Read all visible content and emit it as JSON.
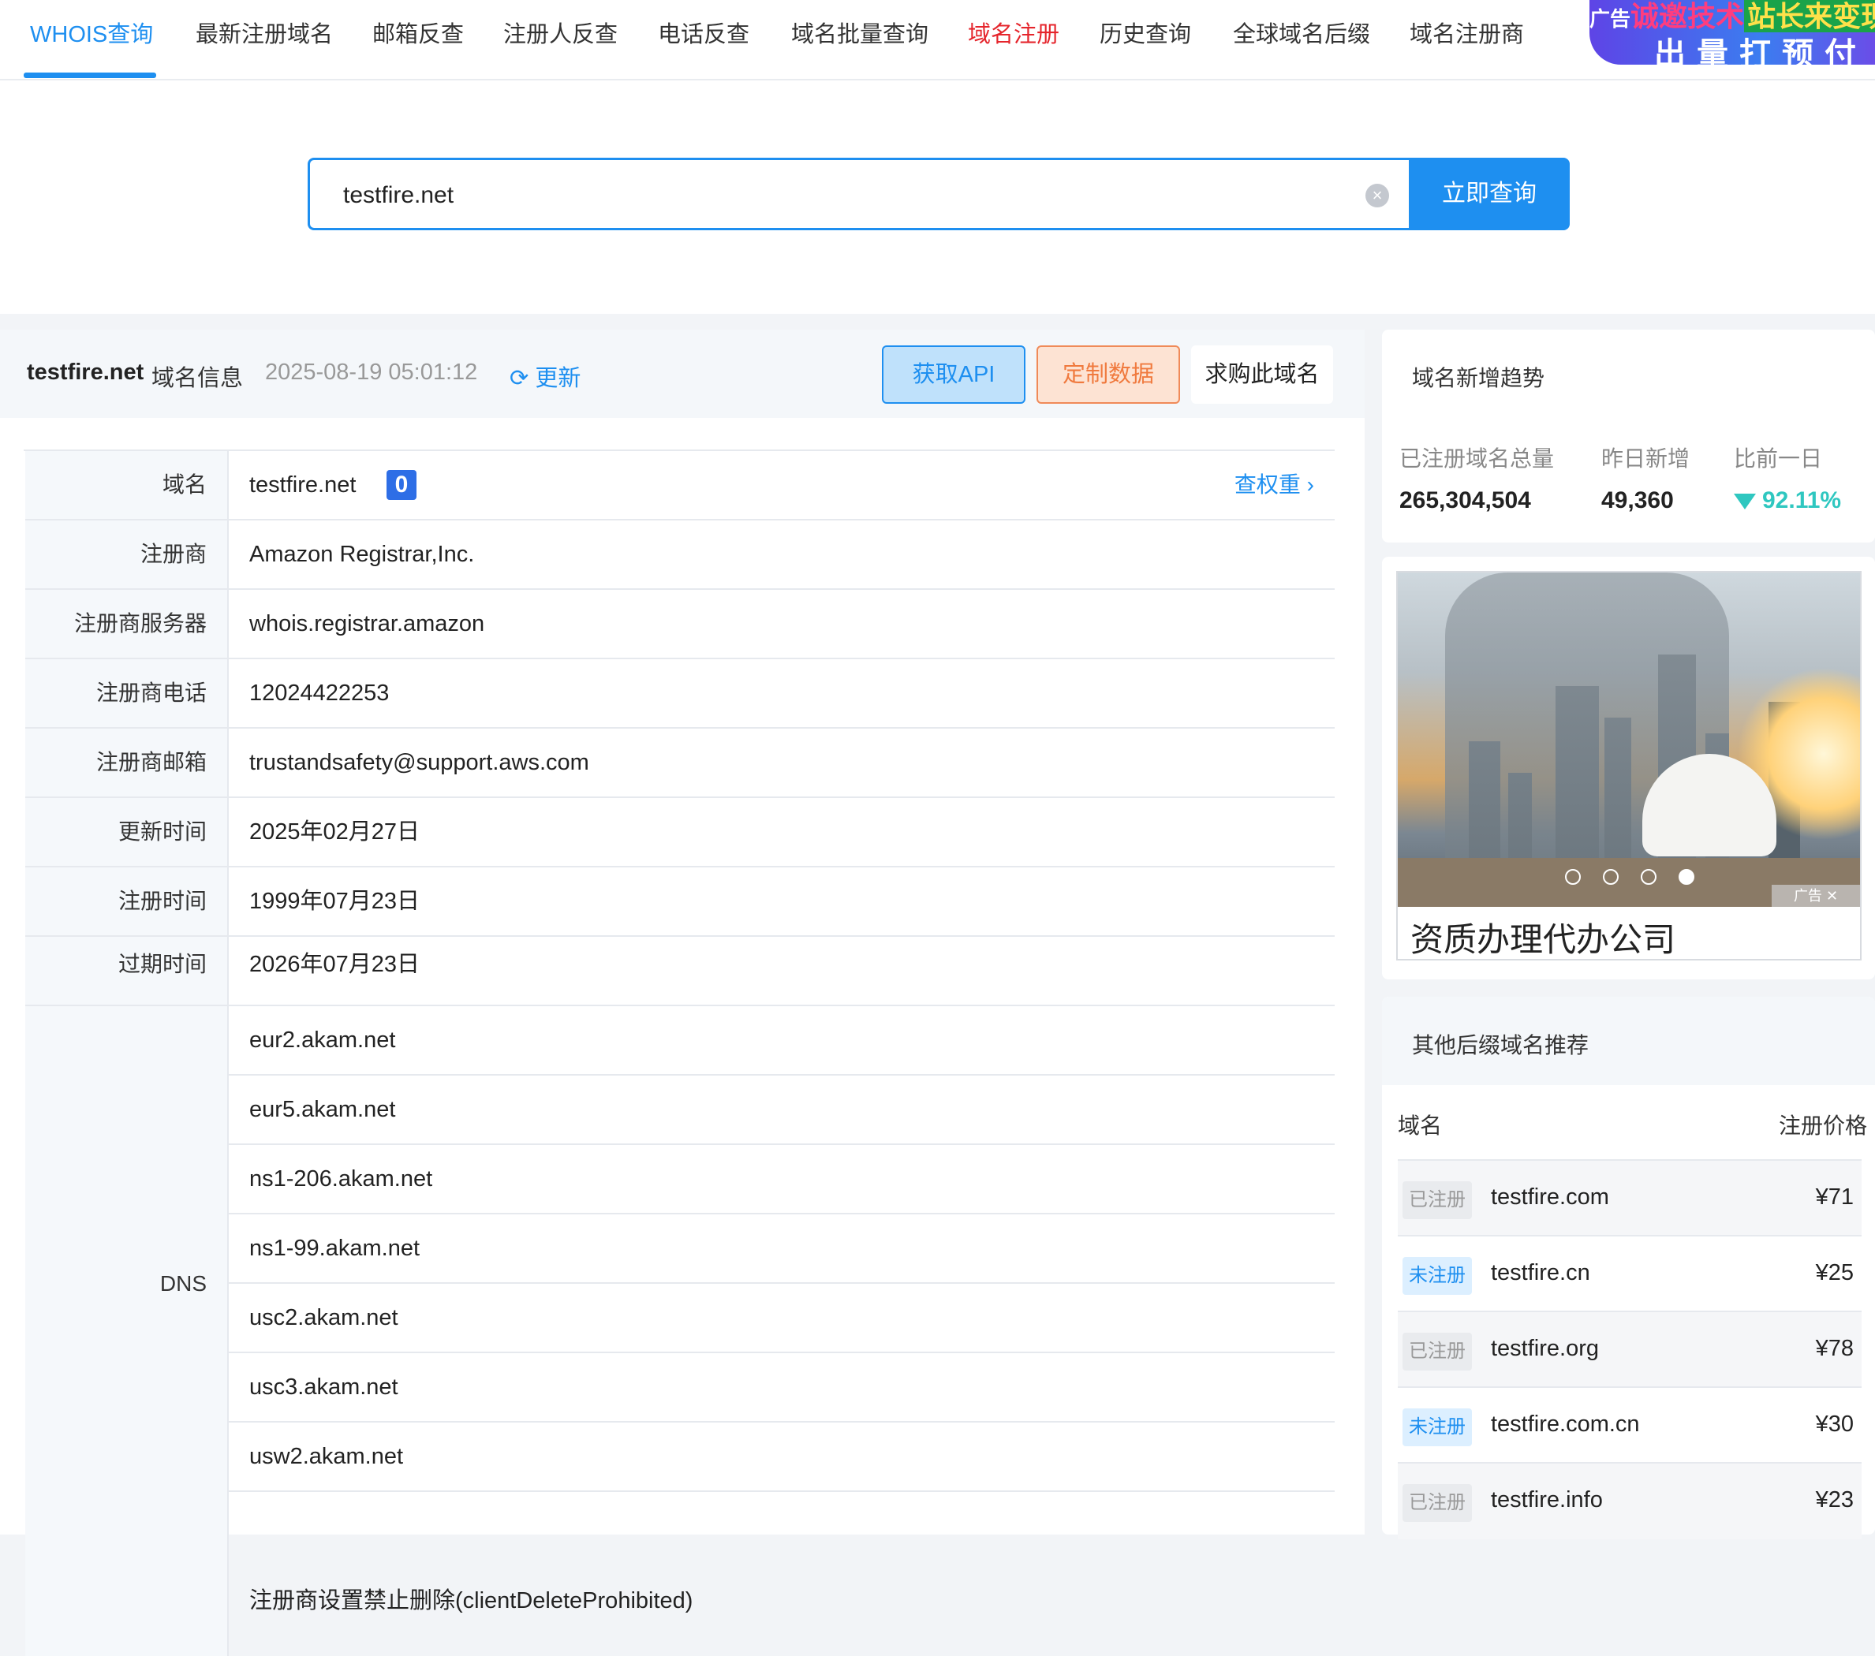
{
  "nav": {
    "items": [
      "WHOIS查询",
      "最新注册域名",
      "邮箱反查",
      "注册人反查",
      "电话反查",
      "域名批量查询",
      "域名注册",
      "历史查询",
      "全球域名后缀",
      "域名注册商"
    ],
    "ad_line1_a": "广告",
    "ad_line1_b": "诚邀技术",
    "ad_line1_c": "站长来变现",
    "ad_line2": "出量打预付"
  },
  "search": {
    "value": "testfire.net",
    "button": "立即查询",
    "clear_icon": "close-circle-icon"
  },
  "info": {
    "domain": "testfire.net",
    "suffix": "域名信息",
    "timestamp": "2025-08-19 05:01:12",
    "refresh_label": "更新",
    "btn_api": "获取API",
    "btn_custom": "定制数据",
    "btn_buy": "求购此域名",
    "rows": [
      {
        "label": "域名",
        "value": "testfire.net"
      },
      {
        "label": "注册商",
        "value": "Amazon Registrar,Inc."
      },
      {
        "label": "注册商服务器",
        "value": "whois.registrar.amazon"
      },
      {
        "label": "注册商电话",
        "value": "12024422253"
      },
      {
        "label": "注册商邮箱",
        "value": "trustandsafety@support.aws.com"
      },
      {
        "label": "更新时间",
        "value": "2025年02月27日"
      },
      {
        "label": "注册时间",
        "value": "1999年07月23日"
      },
      {
        "label": "过期时间",
        "value": "2026年07月23日"
      }
    ],
    "weight_badge": "0",
    "weight_link": "查权重",
    "dns_label": "DNS",
    "dns": [
      "eur2.akam.net",
      "eur5.akam.net",
      "ns1-206.akam.net",
      "ns1-99.akam.net",
      "usc2.akam.net",
      "usc3.akam.net",
      "usw2.akam.net"
    ],
    "status_first": "注册商设置禁止删除(clientDeleteProhibited)"
  },
  "trend": {
    "title": "域名新增趋势",
    "total_label": "已注册域名总量",
    "total_value": "265,304,504",
    "yesterday_label": "昨日新增",
    "yesterday_value": "49,360",
    "compare_label": "比前一日",
    "compare_value": "92.11%",
    "compare_color": "#2fc7c0"
  },
  "ad": {
    "caption": "资质办理代办公司",
    "tag": "广告",
    "dots": 4,
    "active_dot": 4
  },
  "suggest": {
    "title": "其他后缀域名推荐",
    "col_domain": "域名",
    "col_price": "注册价格",
    "rows": [
      {
        "status": "已注册",
        "domain": "testfire.com",
        "price": "¥71"
      },
      {
        "status": "未注册",
        "domain": "testfire.cn",
        "price": "¥25"
      },
      {
        "status": "已注册",
        "domain": "testfire.org",
        "price": "¥78"
      },
      {
        "status": "未注册",
        "domain": "testfire.com.cn",
        "price": "¥30"
      },
      {
        "status": "已注册",
        "domain": "testfire.info",
        "price": "¥23"
      }
    ]
  },
  "colors": {
    "primary": "#1e8ff0",
    "nav_red": "#e5252c",
    "orange": "#f07a3e"
  }
}
